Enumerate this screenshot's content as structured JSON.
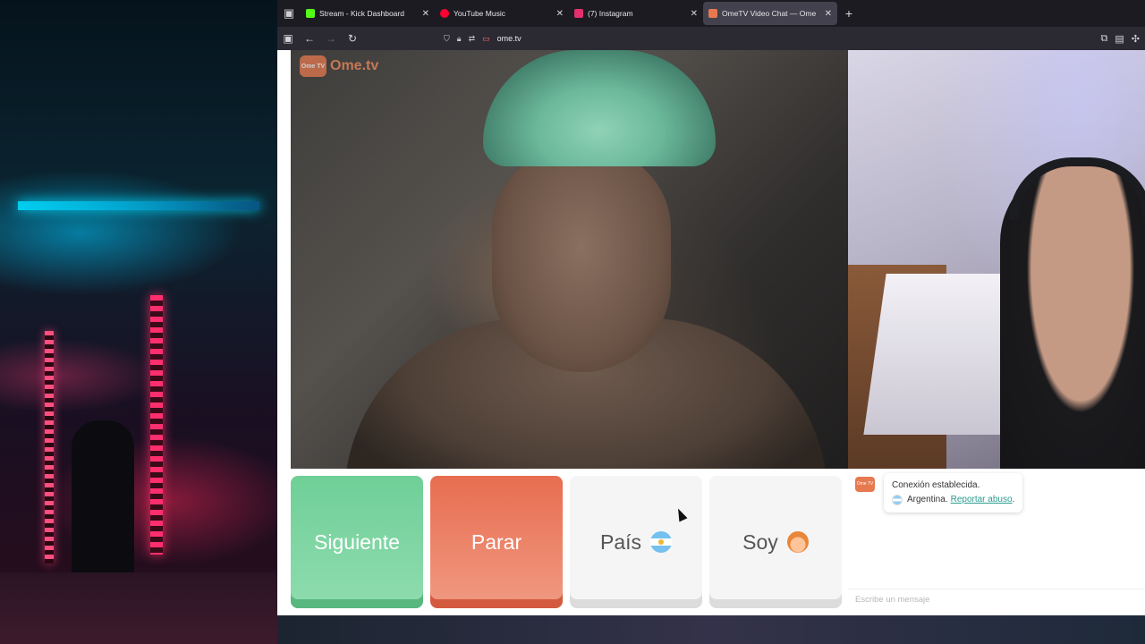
{
  "browser": {
    "tabs": [
      {
        "title": "Stream - Kick Dashboard",
        "favicon_color": "#53fc18",
        "active": false
      },
      {
        "title": "YouTube Music",
        "favicon_color": "#ff0033",
        "active": false
      },
      {
        "title": "(7) Instagram",
        "favicon_color": "#e1306c",
        "active": false
      },
      {
        "title": "OmeTV Video Chat — Ome",
        "favicon_color": "#e6794f",
        "active": true
      }
    ],
    "new_tab_label": "+",
    "url": "ome.tv"
  },
  "page": {
    "logo_text": "Ome.tv",
    "logo_badge": "Ome TV",
    "buttons": {
      "next": "Siguiente",
      "stop": "Parar",
      "country": "País",
      "gender": "Soy"
    },
    "chat": {
      "status": "Conexión establecida.",
      "country": "Argentina.",
      "report_link": "Reportar abuso",
      "report_suffix": ".",
      "input_placeholder": "Escribe un mensaje"
    }
  },
  "colors": {
    "next_button": "#6fcf97",
    "stop_button": "#e86d50",
    "brand": "#e6794f",
    "report_link": "#2a9d8f"
  }
}
